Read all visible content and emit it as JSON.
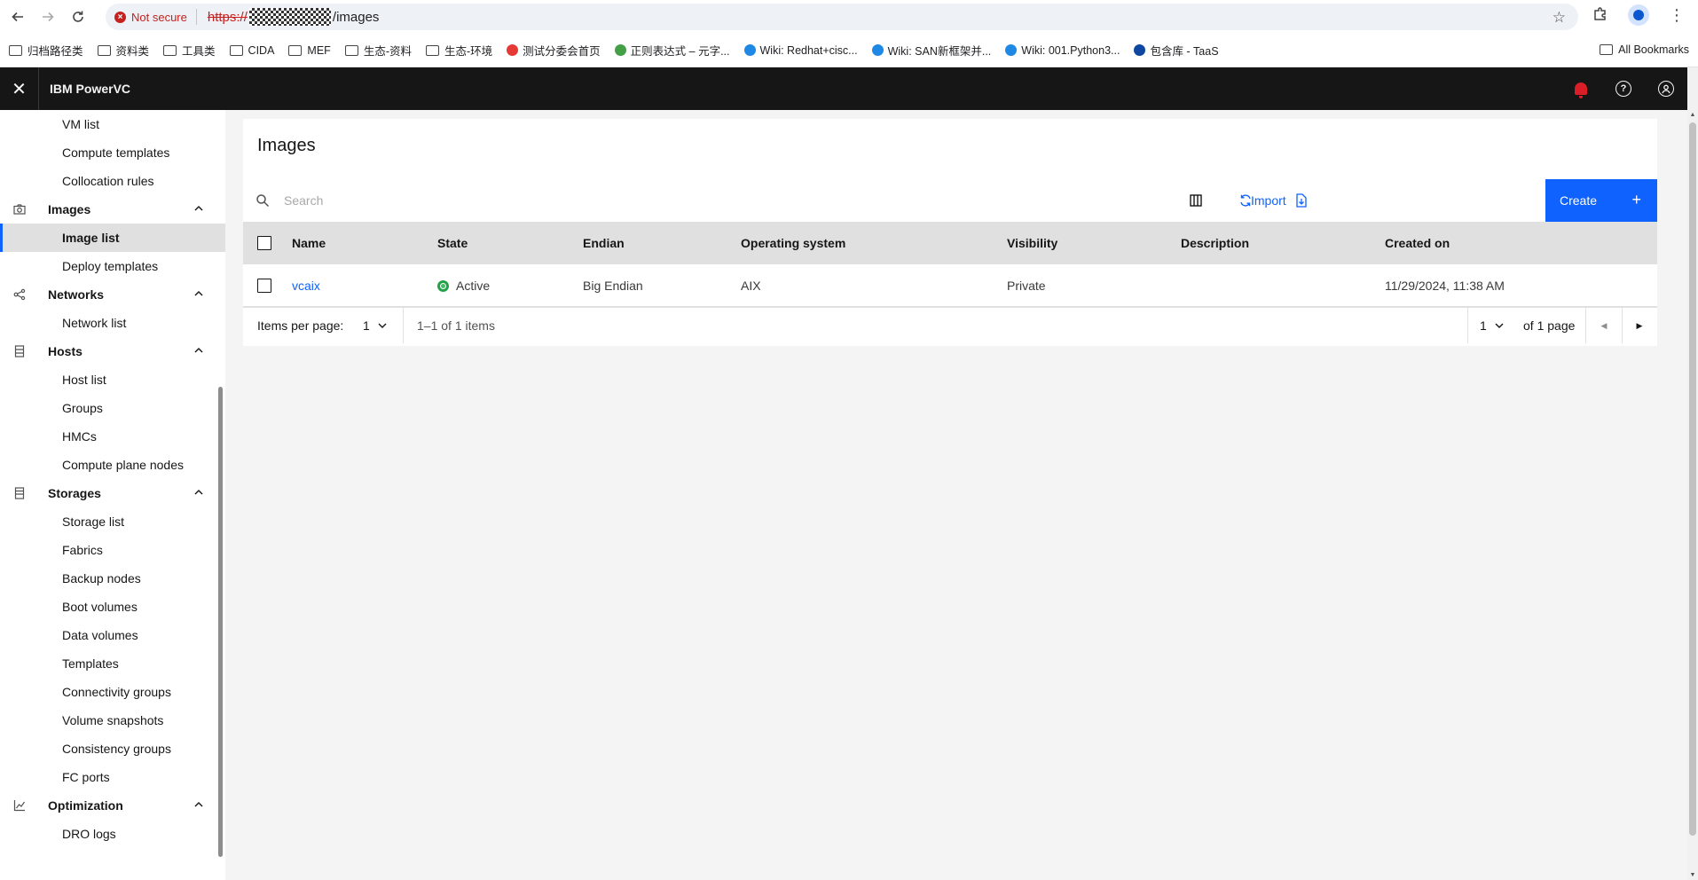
{
  "browser": {
    "security_label": "Not secure",
    "url_scheme": "https://",
    "url_path": "/images",
    "bookmarks": [
      {
        "label": "归档路径类",
        "kind": "folder"
      },
      {
        "label": "资料类",
        "kind": "folder"
      },
      {
        "label": "工具类",
        "kind": "folder"
      },
      {
        "label": "CIDA",
        "kind": "folder"
      },
      {
        "label": "MEF",
        "kind": "folder"
      },
      {
        "label": "生态-资料",
        "kind": "folder"
      },
      {
        "label": "生态-环境",
        "kind": "folder"
      },
      {
        "label": "测试分委会首页",
        "kind": "site",
        "color": "#e53935"
      },
      {
        "label": "正则表达式 – 元字...",
        "kind": "site",
        "color": "#43a047"
      },
      {
        "label": "Wiki: Redhat+cisc...",
        "kind": "site",
        "color": "#1e88e5"
      },
      {
        "label": "Wiki: SAN新框架并...",
        "kind": "site",
        "color": "#1e88e5"
      },
      {
        "label": "Wiki: 001.Python3...",
        "kind": "site",
        "color": "#1e88e5"
      },
      {
        "label": "包含库 - TaaS",
        "kind": "site",
        "color": "#0d47a1"
      }
    ],
    "all_bookmarks": "All Bookmarks"
  },
  "header": {
    "product_name": "IBM PowerVC",
    "icons": [
      "close-icon",
      "notification-icon",
      "help-icon",
      "user-icon"
    ],
    "notification_color": "#da1e28"
  },
  "sidenav": {
    "items": [
      {
        "type": "leaf",
        "label": "VM list"
      },
      {
        "type": "leaf",
        "label": "Compute templates"
      },
      {
        "type": "leaf",
        "label": "Collocation rules"
      },
      {
        "type": "group",
        "label": "Images",
        "icon": "camera-icon"
      },
      {
        "type": "leaf",
        "label": "Image list",
        "active": true
      },
      {
        "type": "leaf",
        "label": "Deploy templates"
      },
      {
        "type": "group",
        "label": "Networks",
        "icon": "network-icon"
      },
      {
        "type": "leaf",
        "label": "Network list"
      },
      {
        "type": "group",
        "label": "Hosts",
        "icon": "server-icon"
      },
      {
        "type": "leaf",
        "label": "Host list"
      },
      {
        "type": "leaf",
        "label": "Groups"
      },
      {
        "type": "leaf",
        "label": "HMCs"
      },
      {
        "type": "leaf",
        "label": "Compute plane nodes"
      },
      {
        "type": "group",
        "label": "Storages",
        "icon": "storage-icon"
      },
      {
        "type": "leaf",
        "label": "Storage list"
      },
      {
        "type": "leaf",
        "label": "Fabrics"
      },
      {
        "type": "leaf",
        "label": "Backup nodes"
      },
      {
        "type": "leaf",
        "label": "Boot volumes"
      },
      {
        "type": "leaf",
        "label": "Data volumes"
      },
      {
        "type": "leaf",
        "label": "Templates"
      },
      {
        "type": "leaf",
        "label": "Connectivity groups"
      },
      {
        "type": "leaf",
        "label": "Volume snapshots"
      },
      {
        "type": "leaf",
        "label": "Consistency groups"
      },
      {
        "type": "leaf",
        "label": "FC ports"
      },
      {
        "type": "group",
        "label": "Optimization",
        "icon": "chart-icon"
      },
      {
        "type": "leaf",
        "label": "DRO logs"
      }
    ]
  },
  "main": {
    "title": "Images",
    "search_placeholder": "Search",
    "toolbar": {
      "import_label": "Import",
      "create_label": "Create",
      "accent_color": "#0f62fe"
    },
    "table": {
      "columns": [
        "Name",
        "State",
        "Endian",
        "Operating system",
        "Visibility",
        "Description",
        "Created on"
      ],
      "rows": [
        {
          "name": "vcaix",
          "state": "Active",
          "state_color": "#24a148",
          "endian": "Big Endian",
          "os": "AIX",
          "visibility": "Private",
          "description": "",
          "created_on": "11/29/2024, 11:38 AM"
        }
      ]
    },
    "pagination": {
      "items_per_page_label": "Items per page:",
      "items_per_page_value": "1",
      "range_label": "1–1 of 1 items",
      "page_value": "1",
      "page_total_label": "of 1 page"
    }
  }
}
